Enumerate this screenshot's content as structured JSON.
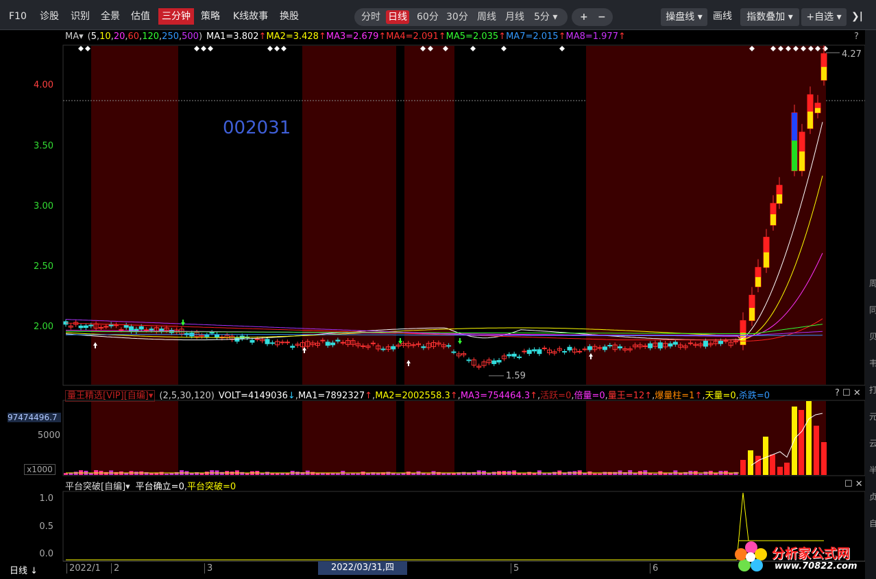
{
  "toolbar": {
    "left_items": [
      "F10",
      "诊股",
      "识别",
      "全景",
      "估值",
      "三分钟",
      "策略",
      "K线故事",
      "换股"
    ],
    "active_left": "三分钟",
    "period_tabs": [
      "分时",
      "日线",
      "60分",
      "30分",
      "周线",
      "月线",
      "5分 ▾"
    ],
    "active_period": "日线",
    "zoom_in": "+",
    "zoom_out": "−",
    "operate_line": "操盘线 ▾",
    "draw_line": "画线",
    "index_overlay": "指数叠加 ▾",
    "self_select": "+自选 ▾",
    "collapse": "❯|"
  },
  "price_pane": {
    "indicator": "MA▾",
    "params_open": "(",
    "params": [
      {
        "text": "5",
        "color": "#ffffff"
      },
      {
        "text": "10",
        "color": "#ffff00"
      },
      {
        "text": "20",
        "color": "#ff33ff"
      },
      {
        "text": "60",
        "color": "#ff3333"
      },
      {
        "text": "120",
        "color": "#33ff33"
      },
      {
        "text": "250",
        "color": "#3399ff"
      },
      {
        "text": "500",
        "color": "#cc33ff"
      }
    ],
    "params_close": ")",
    "ma_values": [
      {
        "label": "MA1=3.802",
        "color": "#ffffff"
      },
      {
        "label": "MA2=3.428",
        "color": "#ffff00"
      },
      {
        "label": "MA3=2.679",
        "color": "#ff33ff"
      },
      {
        "label": "MA4=2.091",
        "color": "#ff3333"
      },
      {
        "label": "MA5=2.035",
        "color": "#33ff33"
      },
      {
        "label": "MA7=2.015",
        "color": "#3399ff"
      },
      {
        "label": "MA8=1.977",
        "color": "#cc33ff"
      }
    ],
    "up_arrow": "↑",
    "help": "?",
    "stock_code": "002031",
    "y_ticks": [
      {
        "label": "4.00",
        "value": 4.0,
        "color": "#ff4040"
      },
      {
        "label": "3.50",
        "value": 3.5,
        "color": "#33dd33"
      },
      {
        "label": "3.00",
        "value": 3.0,
        "color": "#33dd33"
      },
      {
        "label": "2.50",
        "value": 2.5,
        "color": "#33dd33"
      },
      {
        "label": "2.00",
        "value": 2.0,
        "color": "#33dd33"
      }
    ],
    "high_label": "4.27",
    "low_label": "1.59"
  },
  "volume_pane": {
    "indicator": "量王精选[VIP][自编]▾",
    "params": "(2,5,30,120)",
    "values": [
      {
        "label": "VOLT=4149036",
        "arrow": "↓",
        "color": "#ffffff"
      },
      {
        "label": "MA1=7892327",
        "arrow": "↑",
        "color": "#ffffff"
      },
      {
        "label": "MA2=2002558.3",
        "arrow": "↑",
        "color": "#ffff00"
      },
      {
        "label": "MA3=754464.3",
        "arrow": "↑",
        "color": "#ff33ff"
      },
      {
        "label": "活跃=0",
        "arrow": "",
        "color": "#c02020"
      },
      {
        "label": "倍量=0",
        "arrow": "",
        "color": "#ff33ff"
      },
      {
        "label": "量王=12",
        "arrow": "↑",
        "color": "#ff3333"
      },
      {
        "label": "爆量柱=1",
        "arrow": "↑",
        "color": "#ff8800"
      },
      {
        "label": "天量=0",
        "arrow": "",
        "color": "#ffff00"
      },
      {
        "label": "杀跌=0",
        "arrow": "",
        "color": "#3399ff"
      }
    ],
    "controls": "? ☐ ✕",
    "top_value": "97474496.7",
    "mid_value": "5000",
    "unit": "x1000"
  },
  "breakout_pane": {
    "indicator": "平台突破[自编]▾",
    "values": [
      {
        "label": "平台确立=0",
        "color": "#ffffff"
      },
      {
        "label": "平台突破=0",
        "color": "#ffff00"
      }
    ],
    "controls": "☐ ✕",
    "y_ticks": [
      "1.0",
      "0.5",
      "0.0"
    ]
  },
  "x_axis": {
    "period_label": "日线 ↓",
    "ticks": [
      "2022/1",
      "2",
      "3",
      "5",
      "6"
    ],
    "cursor_date": "2022/03/31,四"
  },
  "right_strip_chars": [
    "周",
    "同",
    "贝",
    "韦",
    "打",
    "元",
    "云",
    "半",
    "贞",
    "自"
  ],
  "watermark": {
    "text": "分析家公式网",
    "url": "www.70822.com"
  },
  "colors": {
    "up": "#ff3333",
    "down": "#33dddd",
    "shade": "#3a0000",
    "accent": "#c8202a"
  }
}
